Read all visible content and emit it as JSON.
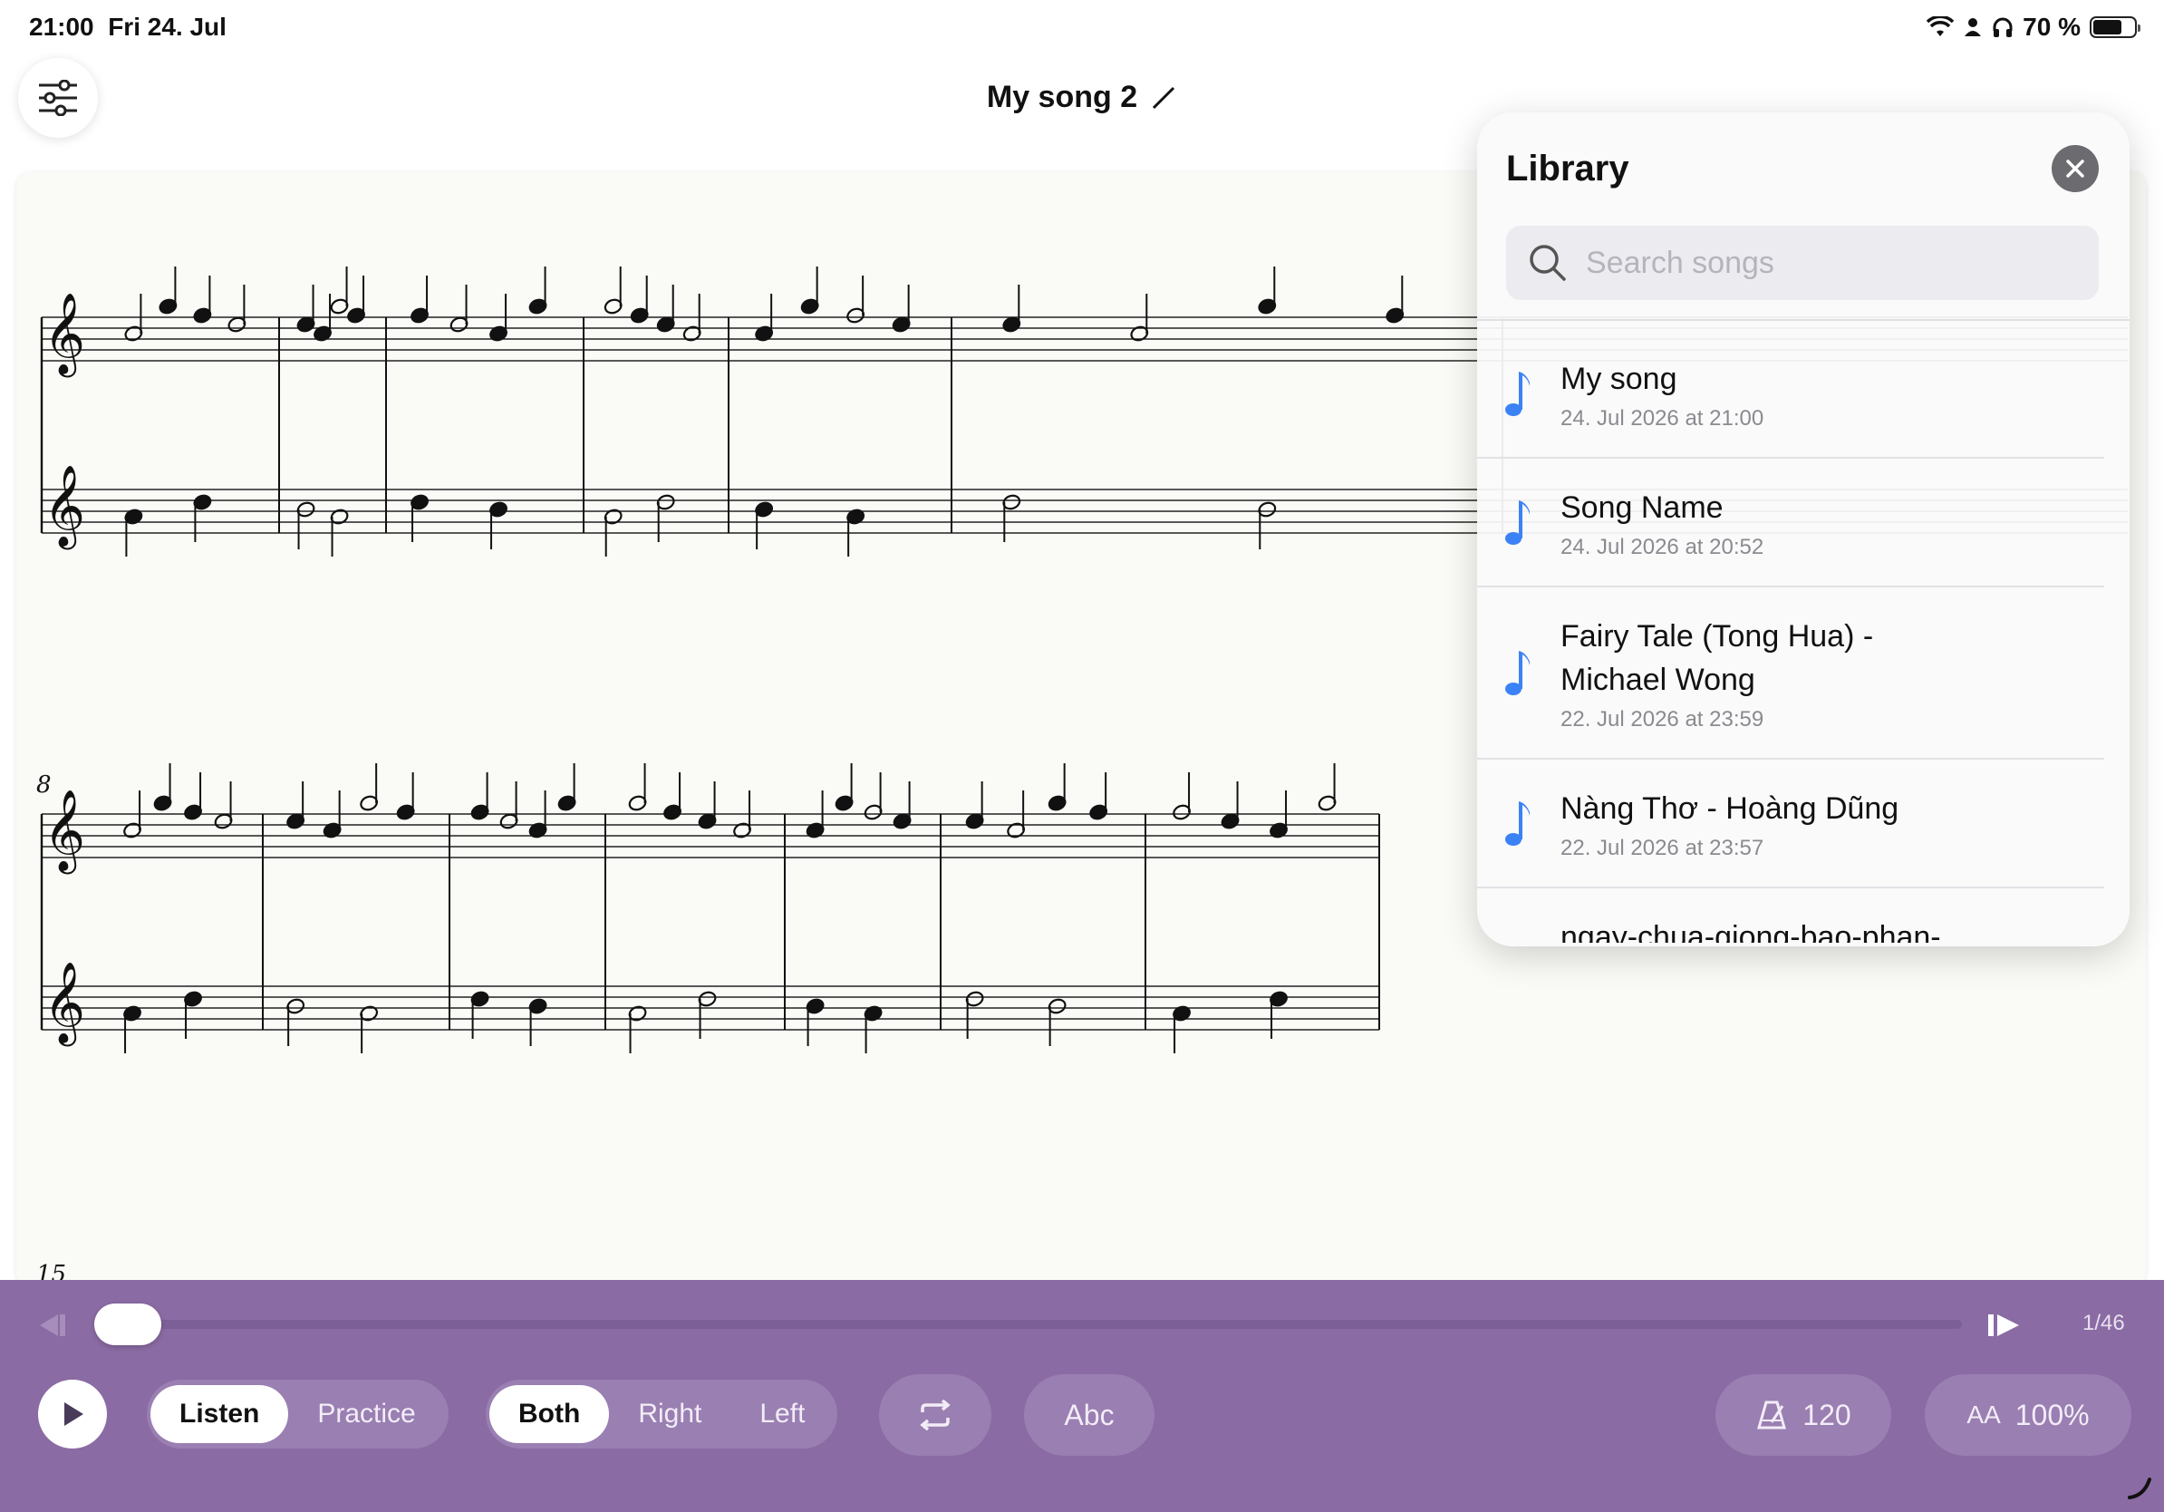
{
  "status": {
    "time": "21:00",
    "date": "Fri 24. Jul",
    "battery": "70 %",
    "battery_level": 0.7
  },
  "header": {
    "title": "My song 2"
  },
  "score": {
    "systems": [
      {
        "measure_number": ""
      },
      {
        "measure_number": "8"
      },
      {
        "measure_number": "15"
      }
    ]
  },
  "library": {
    "title": "Library",
    "search_placeholder": "Search songs",
    "items": [
      {
        "name": "My song",
        "date": "24. Jul 2026 at 21:00"
      },
      {
        "name": "Song Name",
        "date": "24. Jul 2026 at 20:52"
      },
      {
        "name": "Fairy Tale (Tong Hua) - Michael Wong",
        "date": "22. Jul 2026 at 23:59"
      },
      {
        "name": "Nàng Thơ - Hoàng Dũng",
        "date": "22. Jul 2026 at 23:57"
      },
      {
        "name": "ngay-chua-giong-bao-phan-",
        "date": ""
      }
    ]
  },
  "player": {
    "page": "1/46",
    "progress": 0.0,
    "mode_options": [
      "Listen",
      "Practice"
    ],
    "mode_selected": "Listen",
    "hand_options": [
      "Both",
      "Right",
      "Left"
    ],
    "hand_selected": "Both",
    "notation_label": "Abc",
    "tempo": "120",
    "zoom_prefix": "AA",
    "zoom": "100%"
  },
  "colors": {
    "player_bg": "#8a6ba3",
    "note_icon": "#3b82f6"
  },
  "icons": [
    "sliders-icon",
    "pencil-icon",
    "close-icon",
    "search-icon",
    "music-note-icon",
    "skip-back-icon",
    "skip-forward-icon",
    "play-icon",
    "repeat-icon",
    "metronome-icon"
  ]
}
